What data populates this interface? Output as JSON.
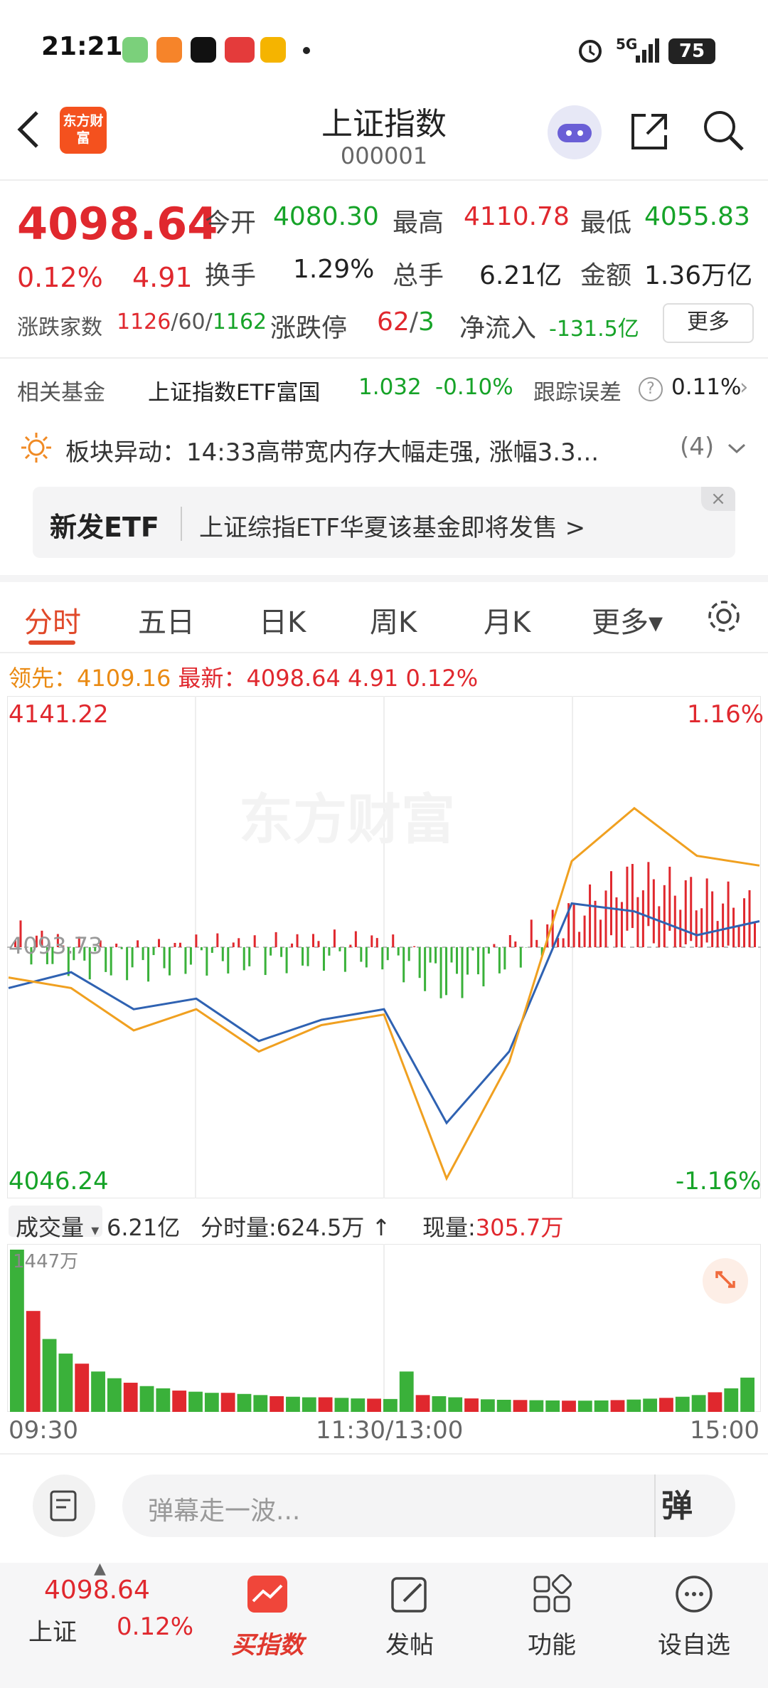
{
  "status_bar": {
    "time": "21:21",
    "network": "5G",
    "battery": "75"
  },
  "header": {
    "title": "上证指数",
    "code": "000001",
    "logo_text": "东方财富",
    "back_icon": "chevron-left-icon",
    "share_icon": "share-icon",
    "search_icon": "search-icon"
  },
  "quote": {
    "price": "4098.64",
    "change_pct": "0.12%",
    "change": "4.91",
    "open_label": "今开",
    "open": "4080.30",
    "high_label": "最高",
    "high": "4110.78",
    "low_label": "最低",
    "low": "4055.83",
    "turnover_label": "换手",
    "turnover": "1.29%",
    "volume_label": "总手",
    "volume": "6.21亿",
    "amount_label": "金额",
    "amount": "1.36万亿",
    "breadth_label": "涨跌家数",
    "adv": "1126",
    "flat": "60",
    "dec": "1162",
    "limit_label": "涨跌停",
    "limit_up": "62",
    "limit_down": "3",
    "inflow_label": "净流入",
    "inflow": "-131.5亿",
    "more_button": "更多"
  },
  "fund": {
    "label": "相关基金",
    "name": "上证指数ETF富国",
    "price": "1.032",
    "pct": "-0.10%",
    "err_label": "跟踪误差",
    "err": "0.11%"
  },
  "sector_alert": {
    "text": "板块异动：14:33高带宽内存大幅走强, 涨幅3.3...",
    "count": "(4)"
  },
  "banner": {
    "tag": "新发ETF",
    "text": "上证综指ETF华夏该基金即将发售 >"
  },
  "tabs": [
    "分时",
    "五日",
    "日K",
    "周K",
    "月K",
    "更多▾"
  ],
  "lead_row": {
    "lead_label": "领先：",
    "lead_value": "4109.16",
    "latest_label": "最新：",
    "latest_value": "4098.64",
    "change": "4.91",
    "pct": "0.12%"
  },
  "chart_labels": {
    "y_high": "4141.22",
    "y_low": "4046.24",
    "pct_high": "1.16%",
    "pct_low": "-1.16%",
    "prev_close": "4093.73",
    "watermark": "东方财富"
  },
  "volume_header": {
    "label": "成交量",
    "total": "6.21亿",
    "tick_label": "分时量:624.5万",
    "current_label": "现量:",
    "current": "305.7万",
    "y_max": "1447万"
  },
  "x_labels": [
    "09:30",
    "11:30/13:00",
    "15:00"
  ],
  "chart_data": {
    "type": "line",
    "title": "",
    "xlabel": "",
    "ylabel": "",
    "ylim": [
      4046.24,
      4141.22
    ],
    "prev_close": 4093.73,
    "x": [
      "09:30",
      "09:50",
      "10:10",
      "10:30",
      "10:50",
      "11:10",
      "11:30",
      "13:20",
      "13:40",
      "14:00",
      "14:20",
      "14:40",
      "15:00"
    ],
    "series": [
      {
        "name": "最新",
        "values": [
          4086.0,
          4089.0,
          4082.0,
          4084.0,
          4076.0,
          4080.0,
          4082.0,
          4060.5,
          4074.0,
          4102.0,
          4100.5,
          4096.0,
          4098.64
        ]
      },
      {
        "name": "领先",
        "values": [
          4088.0,
          4086.0,
          4078.0,
          4082.0,
          4074.0,
          4079.0,
          4081.0,
          4050.0,
          4072.0,
          4110.0,
          4120.0,
          4111.0,
          4109.16
        ]
      }
    ],
    "volume": {
      "ymax": 1447,
      "unit": "万",
      "values": [
        1447,
        900,
        650,
        520,
        430,
        360,
        300,
        260,
        230,
        210,
        190,
        180,
        170,
        170,
        160,
        150,
        140,
        135,
        130,
        130,
        125,
        120,
        118,
        115,
        360,
        150,
        140,
        130,
        120,
        112,
        108,
        106,
        104,
        102,
        100,
        100,
        102,
        105,
        110,
        118,
        125,
        135,
        150,
        175,
        210,
        305.7
      ]
    }
  },
  "comment_bar": {
    "placeholder": "弹幕走一波...",
    "danmu_label": "弹"
  },
  "bottom_nav": {
    "index_name": "上证",
    "index_price": "4098.64",
    "index_pct": "0.12%",
    "items": [
      "买指数",
      "发帖",
      "功能",
      "设自选"
    ]
  }
}
